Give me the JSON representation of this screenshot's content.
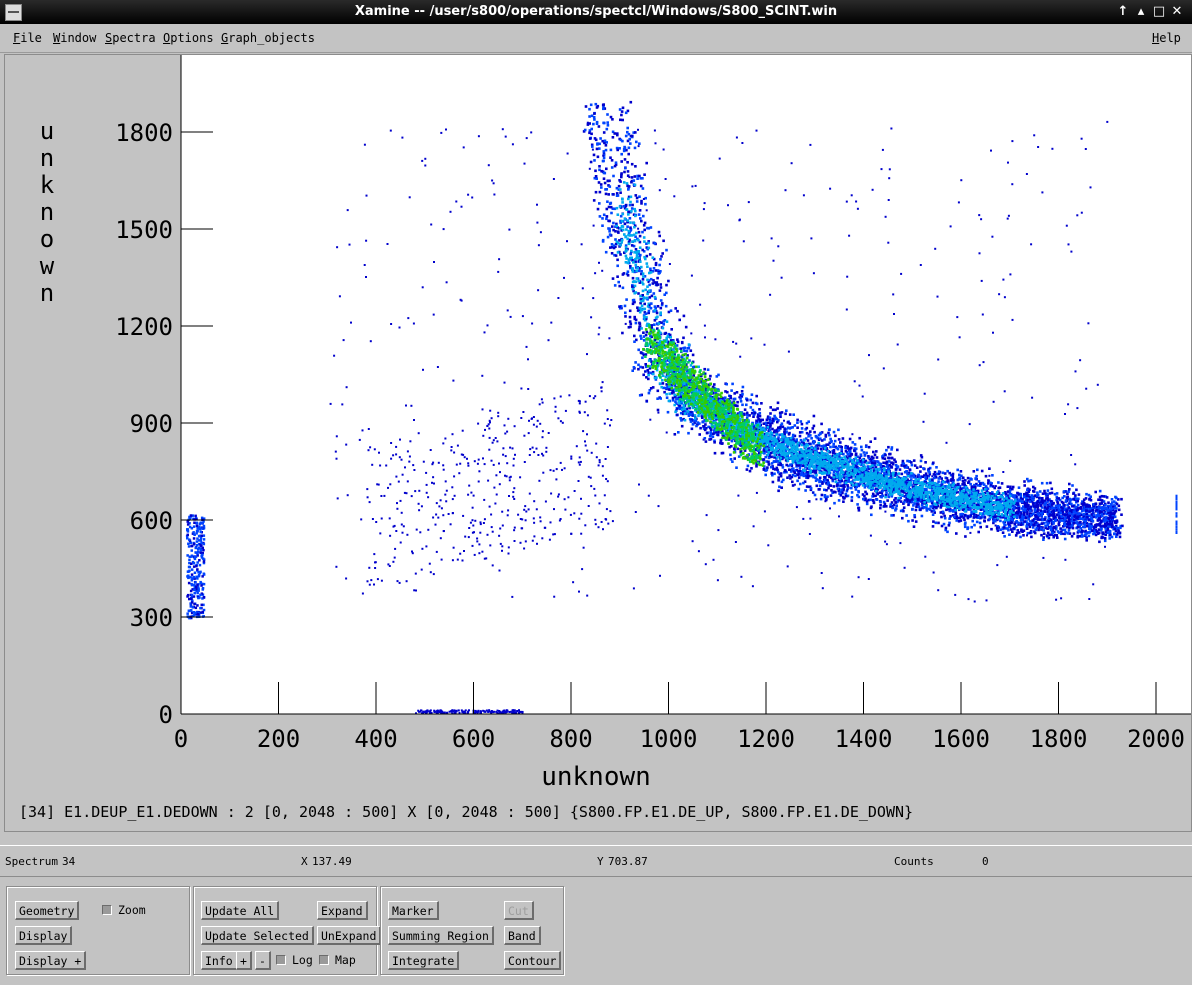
{
  "window": {
    "title": "Xamine -- /user/s800/operations/spectcl/Windows/S800_SCINT.win",
    "controls": [
      "↑",
      "▴",
      "□",
      "✕"
    ]
  },
  "menubar": {
    "items": [
      {
        "label": "File",
        "accel": "F",
        "rest": "ile"
      },
      {
        "label": "Window",
        "accel": "W",
        "rest": "indow"
      },
      {
        "label": "Spectra",
        "accel": "S",
        "rest": "pectra"
      },
      {
        "label": "Options",
        "accel": "O",
        "rest": "ptions"
      },
      {
        "label": "Graph_objects",
        "accel": "G",
        "rest": "raph_objects"
      }
    ],
    "help": {
      "label": "Help",
      "accel": "H",
      "rest": "elp"
    }
  },
  "chart_data": {
    "type": "heatmap",
    "title": "",
    "xlabel": "unknown",
    "ylabel": "unknown",
    "xlim": [
      0,
      2048
    ],
    "ylim": [
      0,
      2048
    ],
    "x_ticks": [
      0,
      200,
      400,
      600,
      800,
      1000,
      1200,
      1400,
      1600,
      1800,
      2000
    ],
    "y_ticks": [
      0,
      300,
      600,
      900,
      1200,
      1500,
      1800
    ],
    "x_tick_labels": [
      "0",
      "200",
      "400",
      "600",
      "800",
      "1000",
      "1200",
      "1400",
      "1600",
      "1800",
      "2000"
    ],
    "y_tick_labels": [
      "0",
      "300",
      "600",
      "900",
      "1200",
      "1500",
      "1800"
    ],
    "color_scale": [
      "#0000cc",
      "#0044ff",
      "#00aaee",
      "#00cc66",
      "#33cc00"
    ],
    "ridge": [
      {
        "x": 870,
        "y": 1900
      },
      {
        "x": 900,
        "y": 1600
      },
      {
        "x": 940,
        "y": 1350
      },
      {
        "x": 980,
        "y": 1100
      },
      {
        "x": 1050,
        "y": 980
      },
      {
        "x": 1150,
        "y": 880
      },
      {
        "x": 1300,
        "y": 790
      },
      {
        "x": 1500,
        "y": 700
      },
      {
        "x": 1700,
        "y": 640
      },
      {
        "x": 1900,
        "y": 610
      }
    ],
    "hotspot": {
      "x_range": [
        960,
        1180
      ],
      "y_range": [
        820,
        1150
      ]
    },
    "low_x_band": {
      "x_range": [
        10,
        45
      ],
      "y_range": [
        300,
        620
      ]
    }
  },
  "spectrum_info": "[34] E1.DEUP_E1.DEDOWN : 2 [0, 2048 : 500] X [0, 2048 : 500] {S800.FP.E1.DE_UP, S800.FP.E1.DE_DOWN}",
  "status": {
    "spectrum_label": "Spectrum",
    "spectrum_value": "34",
    "x_label": "X",
    "x_value": "137.49",
    "y_label": "Y",
    "y_value": "703.87",
    "counts_label": "Counts",
    "counts_value": "0"
  },
  "buttons": {
    "geometry": "Geometry",
    "zoom": "Zoom",
    "display": "Display",
    "display_plus": "Display +",
    "update_all": "Update All",
    "expand": "Expand",
    "update_selected": "Update Selected",
    "unexpand": "UnExpand",
    "info": "Info",
    "plus": "+",
    "minus": "-",
    "log": "Log",
    "map": "Map",
    "marker": "Marker",
    "cut": "Cut",
    "summing_region": "Summing Region",
    "band": "Band",
    "integrate": "Integrate",
    "contour": "Contour"
  }
}
